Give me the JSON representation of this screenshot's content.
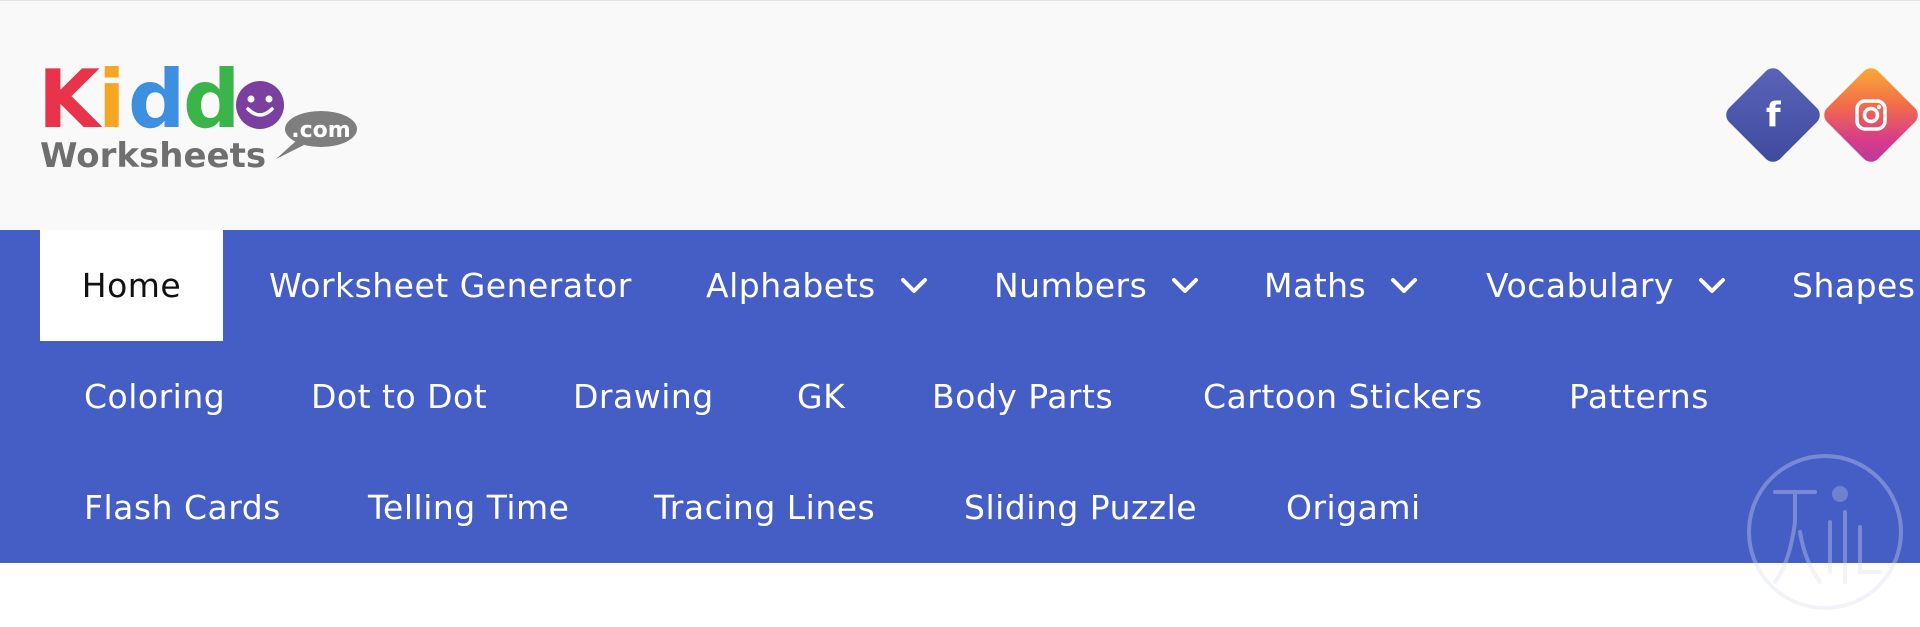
{
  "logo": {
    "word": "Kiddo",
    "sub": "Worksheets",
    "tld": ".com",
    "letter_colors": [
      "#e8334a",
      "#f5a623",
      "#3d8fe0",
      "#3ab54a",
      "#7b3fa0"
    ]
  },
  "social": {
    "facebook_icon": "facebook-icon",
    "facebook_glyph": "f",
    "instagram_icon": "instagram-icon"
  },
  "nav": {
    "rows": [
      [
        {
          "label": "Home",
          "active": true
        },
        {
          "label": "Worksheet Generator"
        },
        {
          "label": "Alphabets",
          "dropdown": true
        },
        {
          "label": "Numbers",
          "dropdown": true
        },
        {
          "label": "Maths",
          "dropdown": true
        },
        {
          "label": "Vocabulary",
          "dropdown": true
        },
        {
          "label": "Shapes"
        }
      ],
      [
        {
          "label": "Coloring"
        },
        {
          "label": "Dot to Dot"
        },
        {
          "label": "Drawing"
        },
        {
          "label": "GK"
        },
        {
          "label": "Body Parts"
        },
        {
          "label": "Cartoon Stickers"
        },
        {
          "label": "Patterns"
        }
      ],
      [
        {
          "label": "Flash Cards"
        },
        {
          "label": "Telling Time"
        },
        {
          "label": "Tracing Lines"
        },
        {
          "label": "Sliding Puzzle"
        },
        {
          "label": "Origami"
        }
      ]
    ]
  },
  "colors": {
    "nav_bg": "#445ec5",
    "header_bg": "#f9f9f9",
    "active_bg": "#ffffff"
  }
}
